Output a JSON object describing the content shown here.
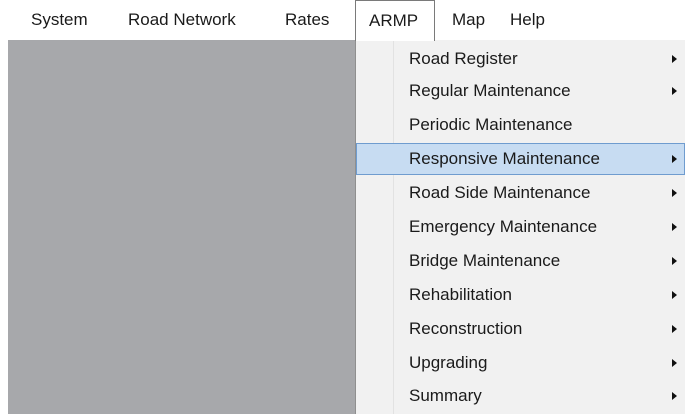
{
  "menubar": {
    "items": [
      {
        "label": "System"
      },
      {
        "label": "Road Network"
      },
      {
        "label": "Rates"
      },
      {
        "label": "ARMP"
      },
      {
        "label": "Map"
      },
      {
        "label": "Help"
      }
    ],
    "open_item": "ARMP"
  },
  "dropdown": {
    "highlighted_item": "Responsive Maintenance",
    "items": [
      {
        "label": "Road Register",
        "icon": "submenu-arrow-icon"
      },
      {
        "label": "Regular Maintenance",
        "icon": "submenu-arrow-icon"
      },
      {
        "label": "Periodic Maintenance"
      },
      {
        "label": "Responsive Maintenance",
        "icon": "submenu-arrow-icon"
      },
      {
        "label": "Road Side Maintenance",
        "icon": "submenu-arrow-icon"
      },
      {
        "label": "Emergency Maintenance",
        "icon": "submenu-arrow-icon"
      },
      {
        "label": "Bridge Maintenance",
        "icon": "submenu-arrow-icon"
      },
      {
        "label": "Rehabilitation",
        "icon": "submenu-arrow-icon"
      },
      {
        "label": "Reconstruction",
        "icon": "submenu-arrow-icon"
      },
      {
        "label": "Upgrading",
        "icon": "submenu-arrow-icon"
      },
      {
        "label": "Summary",
        "icon": "submenu-arrow-icon"
      }
    ]
  },
  "colors": {
    "workspace": "#a7a8ab",
    "menu_background": "#f1f1f1",
    "highlight_fill": "#c7dcf2",
    "highlight_border": "#6f9ccf"
  }
}
